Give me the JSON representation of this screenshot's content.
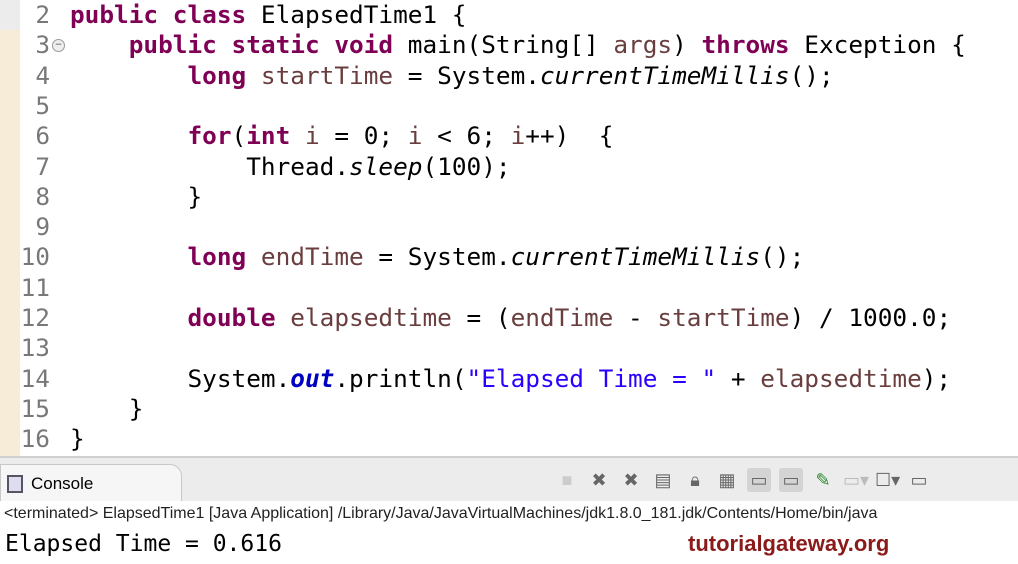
{
  "editor": {
    "lines": [
      {
        "n": "2",
        "t": [
          [
            "k",
            "public class "
          ],
          [
            "p",
            "ElapsedTime1 {"
          ]
        ]
      },
      {
        "n": "3",
        "t": [
          [
            "p",
            "    "
          ],
          [
            "k",
            "public static void "
          ],
          [
            "p",
            "main(String[] "
          ],
          [
            "v",
            "args"
          ],
          [
            "p",
            ") "
          ],
          [
            "k",
            "throws "
          ],
          [
            "p",
            "Exception {"
          ]
        ]
      },
      {
        "n": "4",
        "t": [
          [
            "p",
            "        "
          ],
          [
            "k",
            "long "
          ],
          [
            "v",
            "startTime"
          ],
          [
            "p",
            " = System."
          ],
          [
            "i",
            "currentTimeMillis"
          ],
          [
            "p",
            "();"
          ]
        ]
      },
      {
        "n": "5",
        "t": []
      },
      {
        "n": "6",
        "t": [
          [
            "p",
            "        "
          ],
          [
            "k",
            "for"
          ],
          [
            "p",
            "("
          ],
          [
            "k",
            "int "
          ],
          [
            "v",
            "i"
          ],
          [
            "p",
            " = 0; "
          ],
          [
            "v",
            "i"
          ],
          [
            "p",
            " < 6; "
          ],
          [
            "v",
            "i"
          ],
          [
            "p",
            "++)  {"
          ]
        ]
      },
      {
        "n": "7",
        "t": [
          [
            "p",
            "            Thread."
          ],
          [
            "i",
            "sleep"
          ],
          [
            "p",
            "(100);"
          ]
        ]
      },
      {
        "n": "8",
        "t": [
          [
            "p",
            "        }"
          ]
        ]
      },
      {
        "n": "9",
        "t": []
      },
      {
        "n": "10",
        "t": [
          [
            "p",
            "        "
          ],
          [
            "k",
            "long "
          ],
          [
            "v",
            "endTime"
          ],
          [
            "p",
            " = System."
          ],
          [
            "i",
            "currentTimeMillis"
          ],
          [
            "p",
            "();"
          ]
        ]
      },
      {
        "n": "11",
        "t": []
      },
      {
        "n": "12",
        "t": [
          [
            "p",
            "        "
          ],
          [
            "k",
            "double "
          ],
          [
            "v",
            "elapsedtime"
          ],
          [
            "p",
            " = ("
          ],
          [
            "v",
            "endTime"
          ],
          [
            "p",
            " - "
          ],
          [
            "v",
            "startTime"
          ],
          [
            "p",
            ") / 1000.0;"
          ]
        ]
      },
      {
        "n": "13",
        "t": []
      },
      {
        "n": "14",
        "t": [
          [
            "p",
            "        System."
          ],
          [
            "f",
            "out"
          ],
          [
            "p",
            ".println("
          ],
          [
            "s",
            "\"Elapsed Time = \""
          ],
          [
            "p",
            " + "
          ],
          [
            "v",
            "elapsedtime"
          ],
          [
            "p",
            ");"
          ]
        ]
      },
      {
        "n": "15",
        "t": [
          [
            "p",
            "    }"
          ]
        ]
      },
      {
        "n": "16",
        "t": [
          [
            "p",
            "}"
          ]
        ]
      }
    ]
  },
  "console": {
    "tab_label": "Console",
    "status": "<terminated> ElapsedTime1 [Java Application] /Library/Java/JavaVirtualMachines/jdk1.8.0_181.jdk/Contents/Home/bin/java",
    "output": "Elapsed Time = 0.616"
  },
  "watermark": "tutorialgateway.org"
}
